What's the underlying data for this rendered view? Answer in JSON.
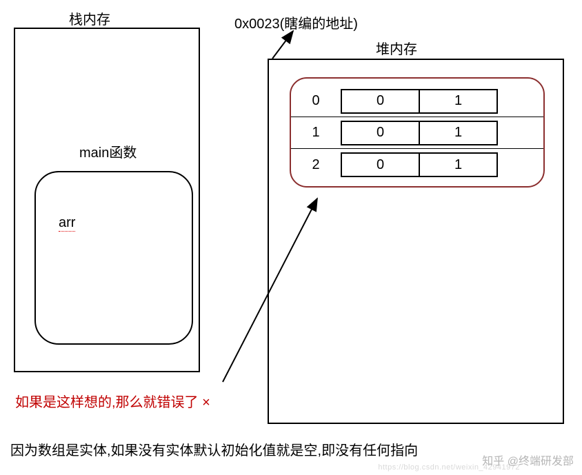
{
  "stack_label": "栈内存",
  "main_label": "main函数",
  "arr_label": "arr",
  "address_label": "0x0023(瞎编的地址)",
  "heap_label": "堆内存",
  "array": {
    "rows": [
      {
        "idx": "0",
        "c0": "0",
        "c1": "1"
      },
      {
        "idx": "1",
        "c0": "0",
        "c1": "1"
      },
      {
        "idx": "2",
        "c0": "0",
        "c1": "1"
      }
    ]
  },
  "error_text": "如果是这样想的,那么就错误了 ×",
  "bottom_text": "因为数组是实体,如果没有实体默认初始化值就是空,即没有任何指向",
  "watermark": "知乎 @终端研发部",
  "watermark2": "https://blog.csdn.net/weixin_42941972"
}
